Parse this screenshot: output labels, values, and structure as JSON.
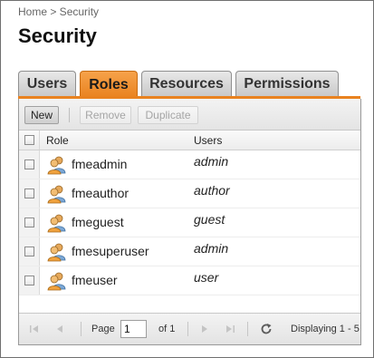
{
  "breadcrumb": "Home > Security",
  "title": "Security",
  "tabs": [
    {
      "label": "Users",
      "active": false
    },
    {
      "label": "Roles",
      "active": true
    },
    {
      "label": "Resources",
      "active": false
    },
    {
      "label": "Permissions",
      "active": false
    }
  ],
  "toolbar": {
    "new_label": "New",
    "remove_label": "Remove",
    "duplicate_label": "Duplicate"
  },
  "grid": {
    "columns": {
      "role": "Role",
      "users": "Users"
    },
    "rows": [
      {
        "role": "fmeadmin",
        "users": "admin"
      },
      {
        "role": "fmeauthor",
        "users": "author"
      },
      {
        "role": "fmeguest",
        "users": "guest"
      },
      {
        "role": "fmesuperuser",
        "users": "admin"
      },
      {
        "role": "fmeuser",
        "users": "user"
      }
    ]
  },
  "pager": {
    "page_label": "Page",
    "page_value": "1",
    "of_label": "of 1",
    "display_text": "Displaying 1 - 5"
  },
  "colors": {
    "accent": "#e9821f",
    "tab_inactive": "#d6d6d6"
  },
  "icons": {
    "role": "role-users-icon",
    "first": "first-page-icon",
    "prev": "prev-page-icon",
    "next": "next-page-icon",
    "last": "last-page-icon",
    "refresh": "refresh-icon"
  }
}
